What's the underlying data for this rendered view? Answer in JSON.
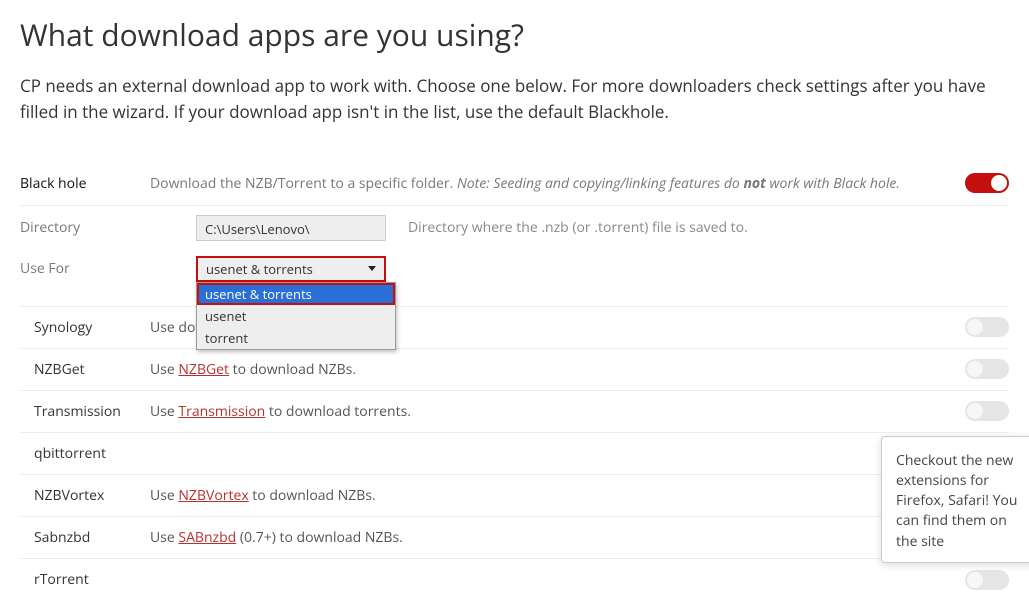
{
  "header": {
    "title": "What download apps are you using?",
    "subtitle": "CP needs an external download app to work with. Choose one below. For more downloaders check settings after you have filled in the wizard. If your download app isn't in the list, use the default Blackhole."
  },
  "blackhole": {
    "label": "Black hole",
    "desc_prefix": "Download the NZB/Torrent to a specific folder. ",
    "desc_note_a": "Note: Seeding and copying/linking features do ",
    "desc_note_bold": "not",
    "desc_note_b": " work with Black hole.",
    "enabled": true
  },
  "directory": {
    "label": "Directory",
    "value": "C:\\Users\\Lenovo\\",
    "hint": "Directory where the .nzb (or .torrent) file is saved to."
  },
  "usefor": {
    "label": "Use For",
    "selected": "usenet & torrents",
    "options": [
      "usenet & torrents",
      "usenet",
      "torrent"
    ]
  },
  "apps": [
    {
      "name": "Synology",
      "text_pre": "Use",
      "link": "",
      "text_post": " download.",
      "enabled": false
    },
    {
      "name": "NZBGet",
      "text_pre": "Use ",
      "link": "NZBGet",
      "text_post": " to download NZBs.",
      "enabled": false
    },
    {
      "name": "Transmission",
      "text_pre": "Use ",
      "link": "Transmission",
      "text_post": " to download torrents.",
      "enabled": false
    },
    {
      "name": "qbittorrent",
      "text_pre": "",
      "link": "",
      "text_post": "",
      "enabled": false
    },
    {
      "name": "NZBVortex",
      "text_pre": "Use ",
      "link": "NZBVortex",
      "text_post": " to download NZBs.",
      "enabled": false
    },
    {
      "name": "Sabnzbd",
      "text_pre": "Use ",
      "link": "SABnzbd",
      "text_post": " (0.7+) to download NZBs.",
      "enabled": false
    },
    {
      "name": "rTorrent",
      "text_pre": "",
      "link": "",
      "text_post": "",
      "enabled": false
    }
  ],
  "tooltip": {
    "text": "Checkout the new extensions for Firefox, Safari! You can find them on the site"
  }
}
